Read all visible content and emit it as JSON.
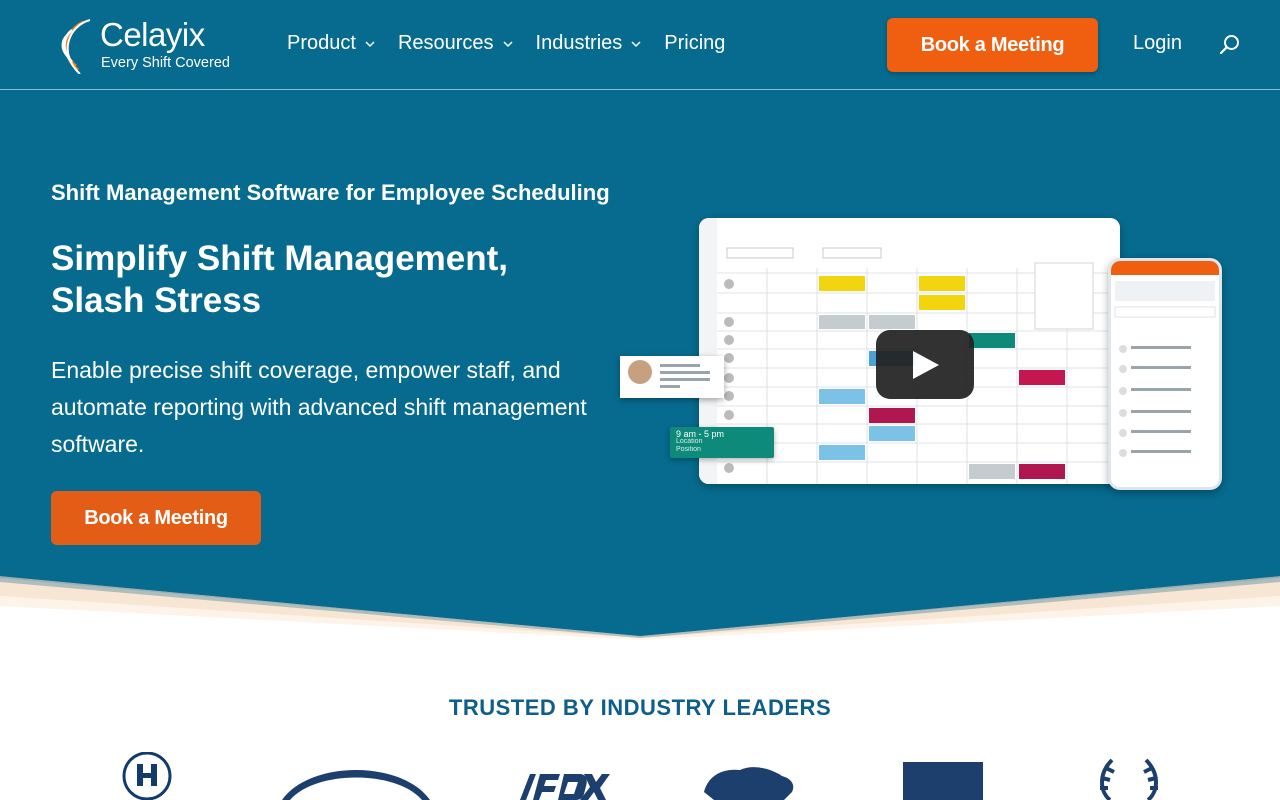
{
  "brand": {
    "name": "Celayix",
    "tagline": "Every Shift Covered"
  },
  "nav": {
    "items": [
      {
        "label": "Product",
        "has_dropdown": true
      },
      {
        "label": "Resources",
        "has_dropdown": true
      },
      {
        "label": "Industries",
        "has_dropdown": true
      },
      {
        "label": "Pricing",
        "has_dropdown": false
      }
    ],
    "cta_label": "Book a Meeting",
    "login_label": "Login",
    "search_icon": "search-icon"
  },
  "hero": {
    "eyebrow": "Shift Management Software for Employee Scheduling",
    "headline": "Simplify Shift Management, Slash Stress",
    "lead": "Enable precise shift coverage, empower staff, and automate reporting with advanced shift management software.",
    "cta_label": "Book a Meeting",
    "mockup": {
      "shift_card_time": "9 am - 5 pm",
      "shift_card_location": "Location",
      "shift_card_position": "Position"
    }
  },
  "trusted": {
    "heading": "TRUSTED BY INDUSTRY LEADERS"
  },
  "colors": {
    "header_bg": "#066b8e",
    "accent": "#f05f10",
    "heading_blue": "#0d5e8a"
  }
}
